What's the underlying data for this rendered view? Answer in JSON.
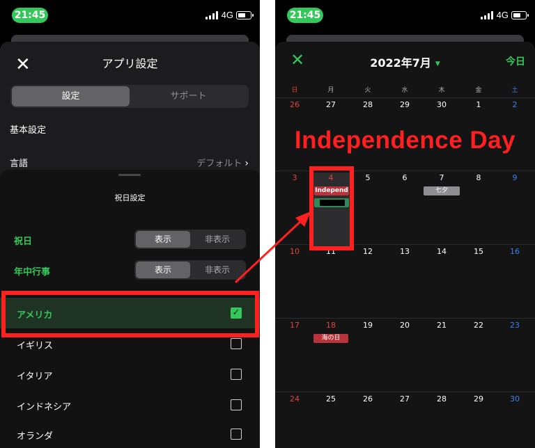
{
  "status_bar": {
    "time": "21:45",
    "network": "4G"
  },
  "settings": {
    "title": "アプリ設定",
    "tabs": [
      "設定",
      "サポート"
    ],
    "section_basic": "基本設定",
    "language_label": "言語",
    "language_value": "デフォルト",
    "holiday_sheet_title": "祝日設定",
    "holiday_label": "祝日",
    "annual_events_label": "年中行事",
    "toggle_options": [
      "表示",
      "非表示"
    ],
    "countries": [
      {
        "name": "アメリカ",
        "checked": true
      },
      {
        "name": "イギリス",
        "checked": false
      },
      {
        "name": "イタリア",
        "checked": false
      },
      {
        "name": "インドネシア",
        "checked": false
      },
      {
        "name": "オランダ",
        "checked": false
      }
    ]
  },
  "calendar": {
    "month_title": "2022年7月",
    "today_label": "今日",
    "weekdays": [
      "日",
      "月",
      "火",
      "水",
      "木",
      "金",
      "土"
    ],
    "weeks": [
      [
        "26",
        "27",
        "28",
        "29",
        "30",
        "1",
        "2"
      ],
      [
        "3",
        "4",
        "5",
        "6",
        "7",
        "8",
        "9"
      ],
      [
        "10",
        "11",
        "12",
        "13",
        "14",
        "15",
        "16"
      ],
      [
        "17",
        "18",
        "19",
        "20",
        "21",
        "22",
        "23"
      ],
      [
        "24",
        "25",
        "26",
        "27",
        "28",
        "29",
        "30"
      ]
    ],
    "events": {
      "independence_short": "Independ",
      "tanabata": "七夕",
      "umi_no_hi": "海の日"
    },
    "annotation": "Independence Day"
  },
  "colors": {
    "accent_green": "#34c759",
    "highlight_red": "#ff2020",
    "sunday": "#e0453a",
    "saturday": "#3b82f6"
  }
}
